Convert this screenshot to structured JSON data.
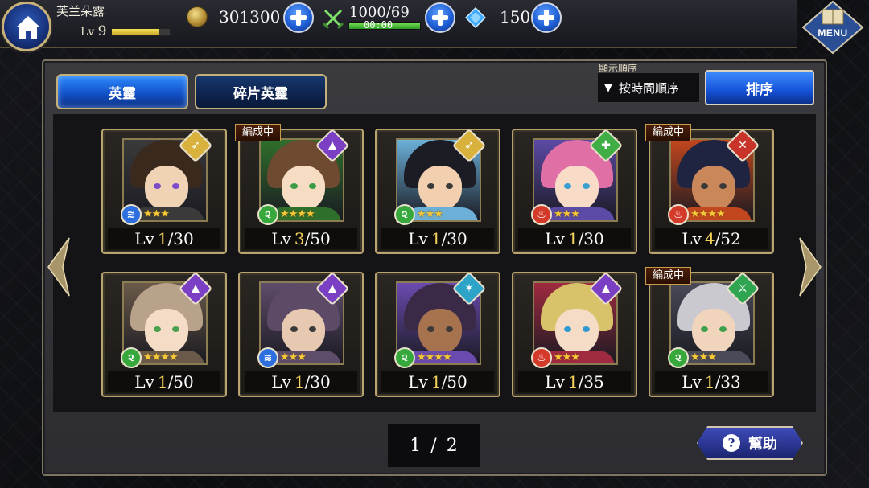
{
  "header": {
    "player_name": "芙兰朵露",
    "level_prefix": "Lv",
    "level": "9",
    "xp_fraction": 0.8,
    "coins": "301300",
    "stamina": "1000/69",
    "stamina_fraction": 1.0,
    "stamina_timer": "00:00",
    "crystals": "150",
    "menu_label": "MENU"
  },
  "tabs": [
    {
      "label": "英靈",
      "active": true
    },
    {
      "label": "碎片英靈",
      "active": false
    }
  ],
  "sort": {
    "caption": "顯示順序",
    "current": "按時間順序",
    "button_label": "排序"
  },
  "heroes": [
    {
      "level": "1",
      "max": "30",
      "stars": 3,
      "element": "water",
      "class": "archer",
      "badge": ""
    },
    {
      "level": "3",
      "max": "50",
      "stars": 4,
      "element": "wind",
      "class": "mage",
      "badge": "編成中"
    },
    {
      "level": "1",
      "max": "30",
      "stars": 3,
      "element": "wind",
      "class": "archer",
      "badge": ""
    },
    {
      "level": "1",
      "max": "30",
      "stars": 3,
      "element": "fire",
      "class": "healer",
      "badge": ""
    },
    {
      "level": "4",
      "max": "52",
      "stars": 4,
      "element": "fire",
      "class": "warrior",
      "badge": "編成中"
    },
    {
      "level": "1",
      "max": "50",
      "stars": 4,
      "element": "wind",
      "class": "mage",
      "badge": ""
    },
    {
      "level": "1",
      "max": "30",
      "stars": 3,
      "element": "water",
      "class": "mage",
      "badge": ""
    },
    {
      "level": "1",
      "max": "50",
      "stars": 4,
      "element": "wind",
      "class": "lancer",
      "badge": ""
    },
    {
      "level": "1",
      "max": "35",
      "stars": 3,
      "element": "fire",
      "class": "mage",
      "badge": ""
    },
    {
      "level": "1",
      "max": "33",
      "stars": 3,
      "element": "wind",
      "class": "swordsman",
      "badge": "編成中"
    }
  ],
  "level_prefix": "Lv",
  "pager": {
    "current": "1",
    "total": "2",
    "separator": "/"
  },
  "help_label": "幫助"
}
